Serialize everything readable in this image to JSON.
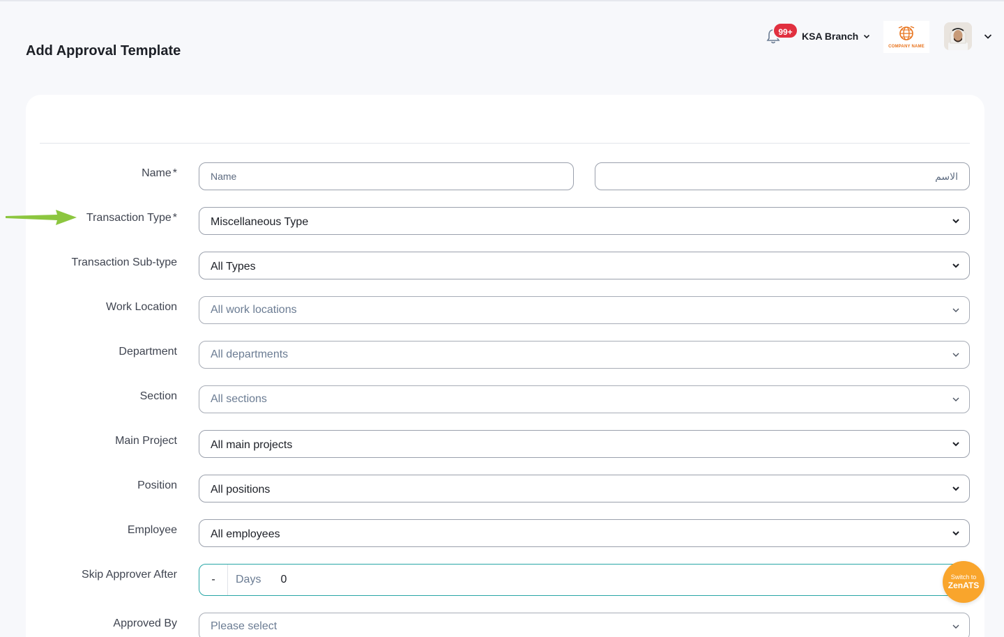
{
  "page": {
    "title": "Add Approval Template"
  },
  "header": {
    "notifications_badge": "99+",
    "branch_label": "KSA Branch",
    "company_logo_text": "COMPANY NAME"
  },
  "form": {
    "name_label": "Name",
    "required_mark": "*",
    "name_placeholder": "Name",
    "name_ar_placeholder": "الاسم",
    "transaction_type_label": "Transaction Type",
    "transaction_type_value": "Miscellaneous Type",
    "transaction_subtype_label": "Transaction Sub-type",
    "transaction_subtype_value": "All Types",
    "work_location_label": "Work Location",
    "work_location_value": "All work locations",
    "department_label": "Department",
    "department_value": "All departments",
    "section_label": "Section",
    "section_value": "All sections",
    "main_project_label": "Main Project",
    "main_project_value": "All main projects",
    "position_label": "Position",
    "position_value": "All positions",
    "employee_label": "Employee",
    "employee_value": "All employees",
    "skip_label": "Skip Approver After",
    "skip_minus": "-",
    "skip_unit": "Days",
    "skip_value": "0",
    "approved_by_label": "Approved By",
    "approved_by_value": "Please select"
  },
  "fab": {
    "line1": "Switch to",
    "line2": "ZenATS"
  },
  "colors": {
    "accent_teal": "#27a6a6",
    "badge_red": "#e1303f",
    "fab_orange": "#f9a52c",
    "arrow_green": "#8cc63f"
  }
}
